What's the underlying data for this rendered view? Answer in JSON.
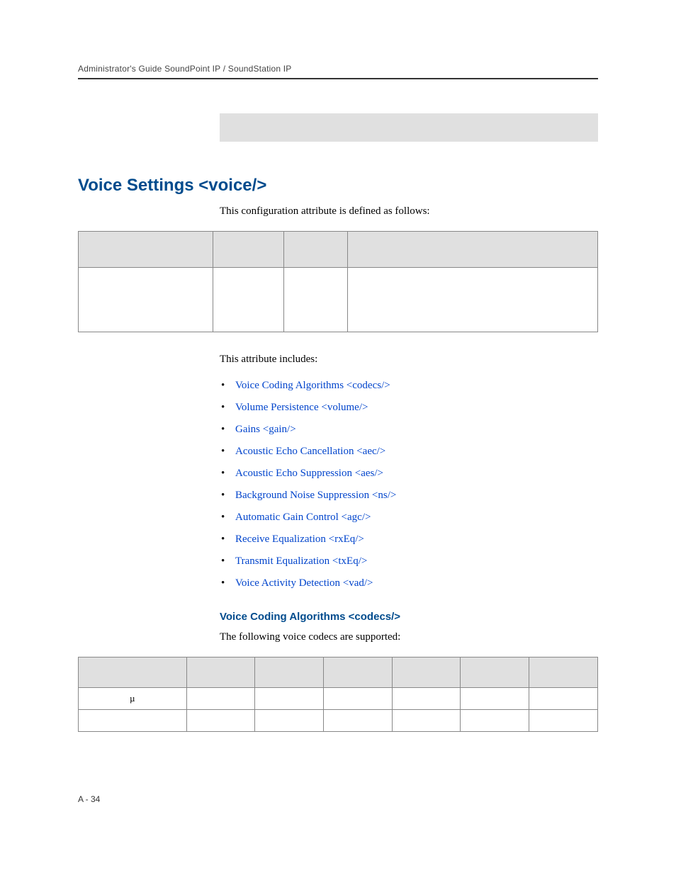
{
  "header": {
    "running_head": "Administrator's Guide SoundPoint IP / SoundStation IP"
  },
  "section": {
    "title": "Voice Settings <voice/>",
    "intro": "This configuration attribute is defined as follows:",
    "after_table": "This attribute includes:",
    "links": [
      "Voice Coding Algorithms <codecs/>",
      "Volume Persistence <volume/>",
      "Gains <gain/>",
      "Acoustic Echo Cancellation <aec/>",
      "Acoustic Echo Suppression <aes/>",
      "Background Noise Suppression <ns/>",
      "Automatic Gain Control <agc/>",
      "Receive Equalization <rxEq/>",
      "Transmit Equalization <txEq/>",
      "Voice Activity Detection <vad/>"
    ],
    "sub": {
      "title": "Voice Coding Algorithms <codecs/>",
      "intro": "The following voice codecs are supported:"
    }
  },
  "codec_table": {
    "mu": "µ"
  },
  "footer": {
    "page_number": "A - 34"
  }
}
